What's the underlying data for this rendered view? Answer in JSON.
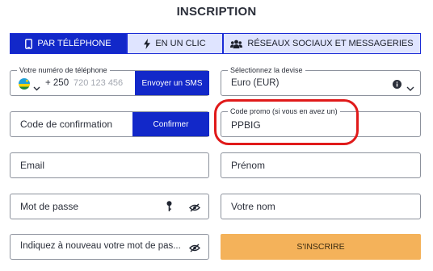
{
  "header": {
    "title": "INSCRIPTION"
  },
  "tabs": [
    {
      "label": "PAR TÉLÉPHONE",
      "icon": "phone-icon",
      "active": true
    },
    {
      "label": "EN UN CLIC",
      "icon": "lightning-icon",
      "active": false
    },
    {
      "label": "RÉSEAUX SOCIAUX ET MESSAGERIES",
      "icon": "users-icon",
      "active": false
    }
  ],
  "phone": {
    "legend": "Votre numéro de téléphone",
    "country_code": "+ 250",
    "placeholder": "720 123 456",
    "send_sms_label": "Envoyer un SMS",
    "flag_icon": "rwanda-flag-icon"
  },
  "currency": {
    "legend": "Sélectionnez la devise",
    "value": "Euro (EUR)"
  },
  "confirmation": {
    "placeholder": "Code de confirmation",
    "button_label": "Confirmer"
  },
  "promo": {
    "legend": "Code promo (si vous en avez un)",
    "value": "PPBIG"
  },
  "email": {
    "placeholder": "Email"
  },
  "firstname": {
    "placeholder": "Prénom"
  },
  "password": {
    "placeholder": "Mot de passe"
  },
  "lastname": {
    "placeholder": "Votre nom"
  },
  "password_repeat": {
    "placeholder": "Indiquez à nouveau votre mot de pas..."
  },
  "submit": {
    "label": "S'INSCRIRE"
  },
  "colors": {
    "accent_blue": "#1228c9",
    "tab_inactive": "#dfe4ff",
    "submit_orange": "#f4b25a",
    "highlight_red": "#e01a1a"
  }
}
